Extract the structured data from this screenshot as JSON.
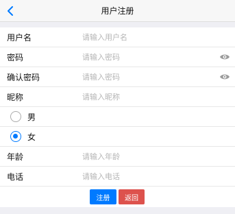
{
  "nav": {
    "title": "用户注册",
    "back_icon": "chevron-left-icon",
    "accent": "#007aff"
  },
  "form": {
    "username": {
      "label": "用户名",
      "placeholder": "请输入用户名",
      "value": ""
    },
    "password": {
      "label": "密码",
      "placeholder": "请输入密码",
      "value": "",
      "icon": "eye-icon"
    },
    "confirm_password": {
      "label": "确认密码",
      "placeholder": "请输入密码",
      "value": "",
      "icon": "eye-icon"
    },
    "nickname": {
      "label": "昵称",
      "placeholder": "请输入昵称",
      "value": ""
    },
    "gender": {
      "options": [
        {
          "label": "男",
          "checked": false
        },
        {
          "label": "女",
          "checked": true
        }
      ]
    },
    "age": {
      "label": "年龄",
      "placeholder": "请输入年龄",
      "value": ""
    },
    "phone": {
      "label": "电话",
      "placeholder": "请输入电话",
      "value": ""
    }
  },
  "buttons": {
    "register_label": "注册",
    "register_color": "#007aff",
    "back_label": "返回",
    "back_color": "#dd524d"
  }
}
